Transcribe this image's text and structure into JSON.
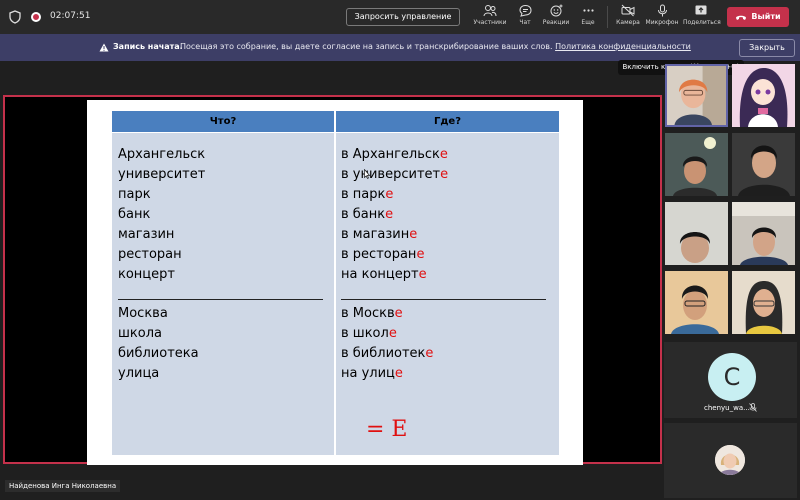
{
  "topbar": {
    "time": "02:07:51",
    "control_label": "Запросить управление",
    "tools": [
      {
        "icon": "participants-icon",
        "label": "Участники"
      },
      {
        "icon": "chat-icon",
        "label": "Чат"
      },
      {
        "icon": "reactions-icon",
        "label": "Реакции"
      },
      {
        "icon": "more-icon",
        "label": "Еще"
      },
      {
        "icon": "camera-off-icon",
        "label": "Камера"
      },
      {
        "icon": "mic-icon",
        "label": "Микрофон"
      },
      {
        "icon": "share-icon",
        "label": "Поделиться"
      }
    ],
    "leave_label": "Выйти"
  },
  "banner": {
    "title": "Запись начата.",
    "text": "Посещая это собрание, вы даете согласие на запись и транскрибирование ваших слов.",
    "link": "Политика конфиденциальности",
    "close_label": "Закрыть"
  },
  "tooltip": "Включить камеру (⌘+SHIFT+O)",
  "slide": {
    "col1_header": "Что?",
    "col2_header": "Где?",
    "words_a": [
      "Архангельск",
      "университет",
      "парк",
      "банк",
      "магазин",
      "ресторан",
      "концерт"
    ],
    "words_b": [
      "Москва",
      "школа",
      "библиотека",
      "улица"
    ],
    "forms_a": [
      {
        "stem": "в Архангельск",
        "end": "е"
      },
      {
        "stem": "в университет",
        "end": "е"
      },
      {
        "stem": "в парк",
        "end": "е"
      },
      {
        "stem": "в банк",
        "end": "е"
      },
      {
        "stem": "в магазин",
        "end": "е"
      },
      {
        "stem": "в ресторан",
        "end": "е"
      },
      {
        "stem": "на концерт",
        "end": "е"
      }
    ],
    "forms_b": [
      {
        "stem": "в Москв",
        "end": "е"
      },
      {
        "stem": "в школ",
        "end": "е"
      },
      {
        "stem": "в библиотек",
        "end": "е"
      },
      {
        "stem": "на улиц",
        "end": "е"
      }
    ],
    "rule": "= E",
    "colors": {
      "header": "#4a7fbf",
      "body": "#cfd8e6",
      "ending": "#e01010"
    }
  },
  "presenter_name": "Найденова Инга Николаевна",
  "participant_c": {
    "initial": "C",
    "name": "chenyu_wa..."
  }
}
